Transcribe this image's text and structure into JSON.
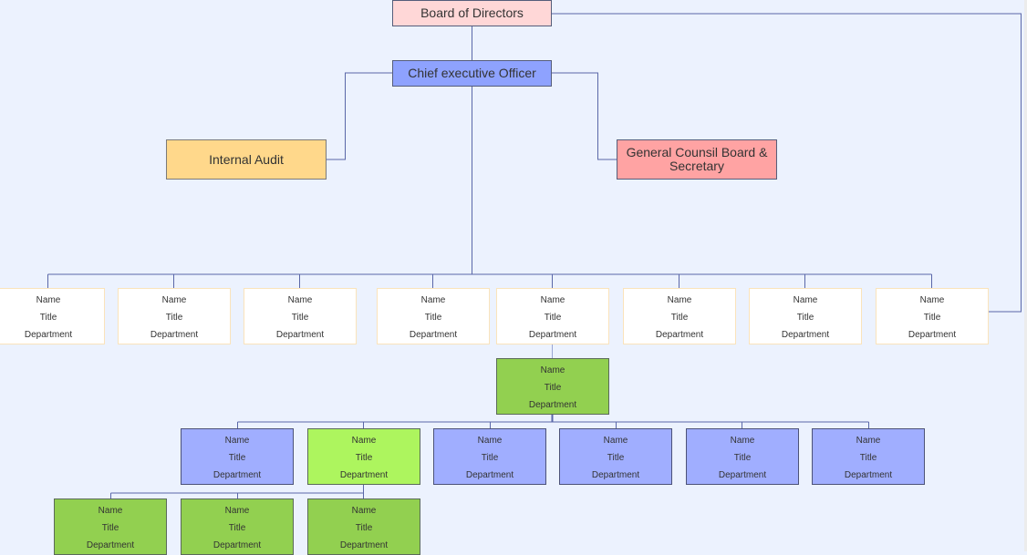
{
  "colors": {
    "background": "#ecf2fe",
    "connector": "#5a67a8",
    "board": "#ffd7d7",
    "ceo": "#8ea2fe",
    "audit": "#ffd88b",
    "counsel": "#ffa3a3",
    "card_white": "#ffffff",
    "card_green": "#92d050",
    "card_lime": "#adf55e",
    "card_blue": "#a0aeff"
  },
  "executives": {
    "board": "Board of Directors",
    "ceo": "Chief executive Officer",
    "audit": "Internal Audit",
    "counsel": "General Counsil Board & Secretary"
  },
  "level1": [
    {
      "name": "Name",
      "title": "Title",
      "department": "Department"
    },
    {
      "name": "Name",
      "title": "Title",
      "department": "Department"
    },
    {
      "name": "Name",
      "title": "Title",
      "department": "Department"
    },
    {
      "name": "Name",
      "title": "Title",
      "department": "Department"
    },
    {
      "name": "Name",
      "title": "Title",
      "department": "Department"
    },
    {
      "name": "Name",
      "title": "Title",
      "department": "Department"
    },
    {
      "name": "Name",
      "title": "Title",
      "department": "Department"
    },
    {
      "name": "Name",
      "title": "Title",
      "department": "Department"
    }
  ],
  "level2": [
    {
      "name": "Name",
      "title": "Title",
      "department": "Department"
    }
  ],
  "level3": [
    {
      "name": "Name",
      "title": "Title",
      "department": "Department"
    },
    {
      "name": "Name",
      "title": "Title",
      "department": "Department"
    },
    {
      "name": "Name",
      "title": "Title",
      "department": "Department"
    },
    {
      "name": "Name",
      "title": "Title",
      "department": "Department"
    },
    {
      "name": "Name",
      "title": "Title",
      "department": "Department"
    },
    {
      "name": "Name",
      "title": "Title",
      "department": "Department"
    }
  ],
  "level4": [
    {
      "name": "Name",
      "title": "Title",
      "department": "Department"
    },
    {
      "name": "Name",
      "title": "Title",
      "department": "Department"
    },
    {
      "name": "Name",
      "title": "Title",
      "department": "Department"
    }
  ]
}
